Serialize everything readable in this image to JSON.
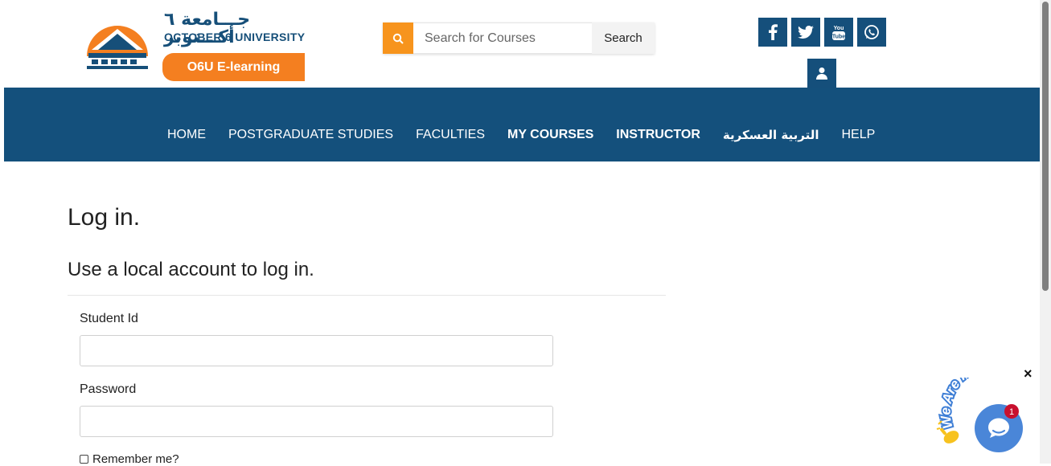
{
  "header": {
    "logo": {
      "arabic_text": "جـــامعة ٦ أكـــتوبر",
      "university_name": "OCTOBER 6 UNIVERSITY",
      "elearning_label": "O6U E-learning"
    },
    "search": {
      "placeholder": "Search for Courses",
      "button_label": "Search",
      "icon": "search-icon"
    },
    "social": [
      {
        "name": "facebook-icon",
        "glyph": "f"
      },
      {
        "name": "twitter-icon",
        "glyph": "twitter"
      },
      {
        "name": "youtube-icon",
        "glyph": "You Tube"
      },
      {
        "name": "whatsapp-icon",
        "glyph": "whatsapp"
      }
    ],
    "user_icon": "user-icon"
  },
  "nav": {
    "items": [
      {
        "label": "HOME"
      },
      {
        "label": "POSTGRADUATE STUDIES"
      },
      {
        "label": "FACULTIES"
      },
      {
        "label": "MY COURSES"
      },
      {
        "label": "INSTRUCTOR"
      },
      {
        "label": "التربية العسكرية"
      },
      {
        "label": "HELP"
      }
    ]
  },
  "main": {
    "title": "Log in.",
    "subtitle": "Use a local account to log in.",
    "student_id_label": "Student Id",
    "student_id_value": "",
    "password_label": "Password",
    "password_value": "",
    "remember_label": "Remember me?"
  },
  "chat_widget": {
    "tagline": "We Are Here!",
    "badge_count": "1",
    "close_label": "×"
  },
  "colors": {
    "nav_bg": "#14507c",
    "accent_orange": "#f47f20",
    "chat_blue": "#4a86d8",
    "badge_red": "#c8102e"
  }
}
